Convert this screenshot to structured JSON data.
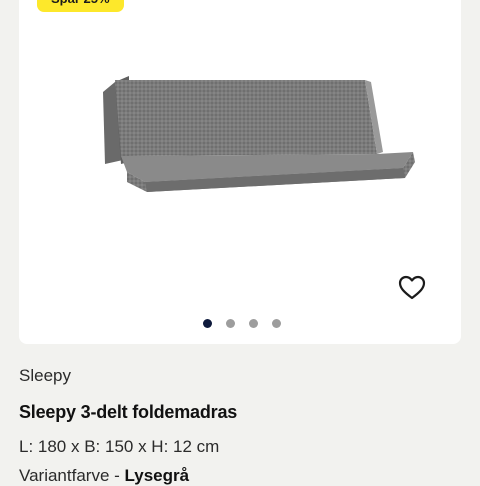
{
  "badge": {
    "label": "Spar 25%"
  },
  "gallery": {
    "image_alt": "Sleepy 3-delt foldemadras",
    "favorite_icon": "heart-outline-icon",
    "dots": [
      {
        "active": true
      },
      {
        "active": false
      },
      {
        "active": false
      },
      {
        "active": false
      }
    ],
    "colors": {
      "active_dot": "#0e1a3c",
      "inactive_dot": "#9d9d9d"
    }
  },
  "product": {
    "brand": "Sleepy",
    "title": "Sleepy 3-delt foldemadras",
    "dimensions": "L: 180 x B: 150 x H: 12 cm",
    "variant_label": "Variantfarve - ",
    "variant_value": "Lysegrå"
  },
  "colors": {
    "badge": "#fde82b",
    "background": "#f2f2ef",
    "card": "#ffffff"
  }
}
